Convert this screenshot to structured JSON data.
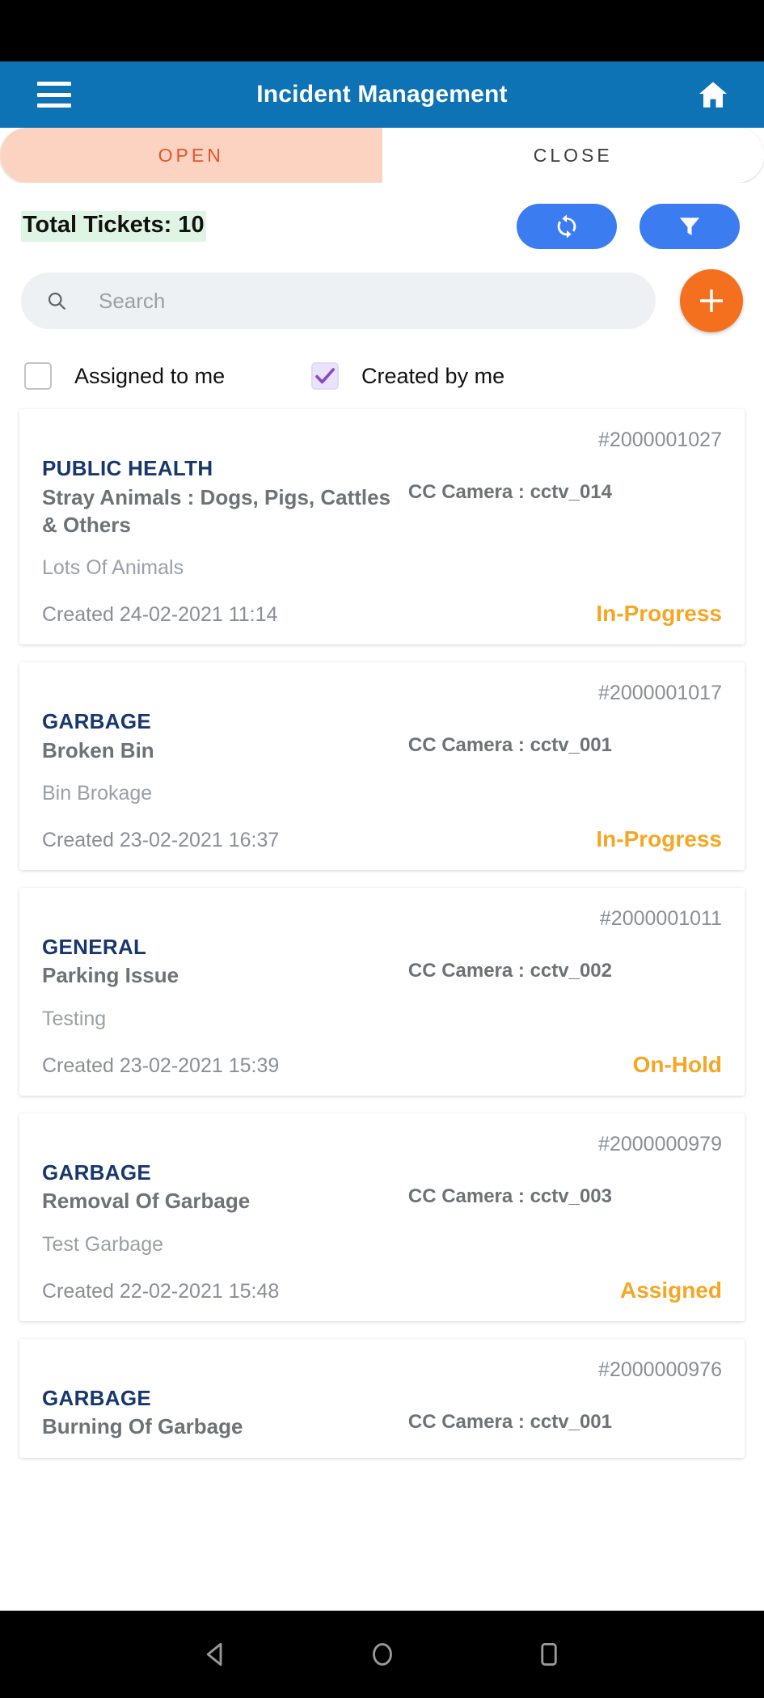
{
  "app_bar": {
    "title": "Incident Management",
    "menu_icon": "hamburger-menu-icon",
    "home_icon": "home-icon"
  },
  "tabs": [
    {
      "label": "OPEN",
      "active": true
    },
    {
      "label": "CLOSE",
      "active": false
    }
  ],
  "toolbar": {
    "total_tickets_label": "Total Tickets: 10",
    "refresh_icon": "refresh-icon",
    "filter_icon": "filter-funnel-icon",
    "accent_blue": "#3b7df0"
  },
  "search": {
    "placeholder": "Search",
    "value": "",
    "icon": "search-icon"
  },
  "add_button": {
    "icon": "plus-icon",
    "color": "#f4701f"
  },
  "filters": [
    {
      "label": "Assigned to me",
      "checked": false
    },
    {
      "label": "Created by me",
      "checked": true
    }
  ],
  "tickets": [
    {
      "id": "#2000001027",
      "department": "PUBLIC HEALTH",
      "subject": "Stray Animals : Dogs, Pigs, Cattles & Others",
      "camera": "CC Camera : cctv_014",
      "description": "Lots Of Animals",
      "created": "Created 24-02-2021 11:14",
      "status": "In-Progress"
    },
    {
      "id": "#2000001017",
      "department": "GARBAGE",
      "subject": "Broken Bin",
      "camera": "CC Camera : cctv_001",
      "description": "Bin Brokage",
      "created": "Created 23-02-2021 16:37",
      "status": "In-Progress"
    },
    {
      "id": "#2000001011",
      "department": "GENERAL",
      "subject": "Parking Issue",
      "camera": "CC Camera : cctv_002",
      "description": "Testing",
      "created": "Created 23-02-2021 15:39",
      "status": "On-Hold"
    },
    {
      "id": "#2000000979",
      "department": "GARBAGE",
      "subject": "Removal Of Garbage",
      "camera": "CC Camera : cctv_003",
      "description": "Test Garbage",
      "created": "Created 22-02-2021 15:48",
      "status": "Assigned"
    },
    {
      "id": "#2000000976",
      "department": "GARBAGE",
      "subject": "Burning Of Garbage",
      "camera": "CC Camera : cctv_001",
      "description": "",
      "created": "",
      "status": ""
    }
  ],
  "nav_bar": {
    "back": "back-triangle-icon",
    "home": "home-circle-icon",
    "recents": "recents-square-icon"
  },
  "colors": {
    "app_bar_blue": "#0d73b5",
    "tab_active_bg": "#fbd3c0",
    "tab_active_text": "#e8532a",
    "status_orange": "#f5a623",
    "dept_blue": "#17376e"
  }
}
